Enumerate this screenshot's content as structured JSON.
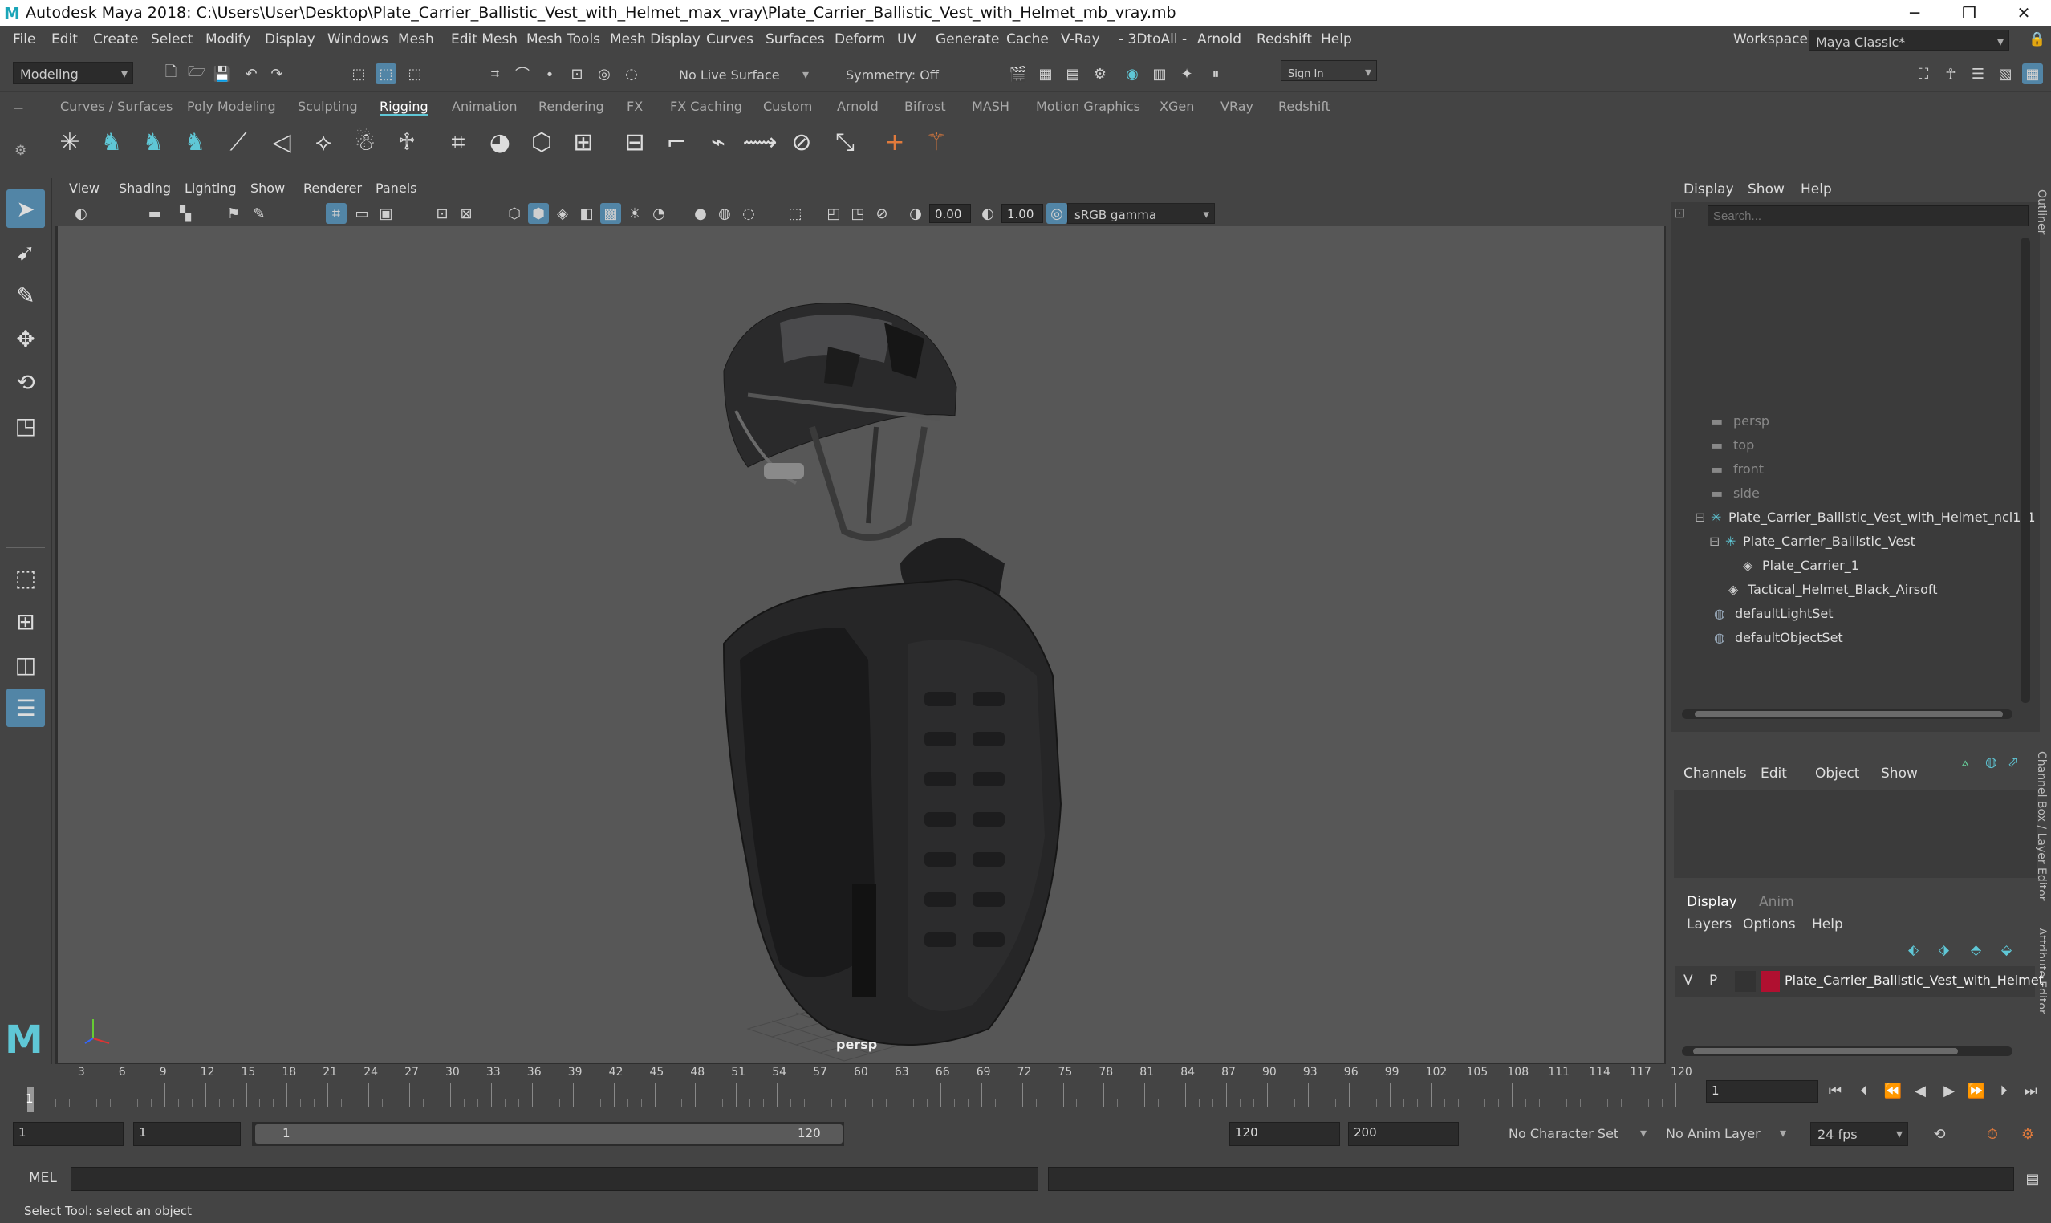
{
  "title_bar": {
    "logo": "M",
    "title": "Autodesk Maya 2018: C:\\Users\\User\\Desktop\\Plate_Carrier_Ballistic_Vest_with_Helmet_max_vray\\Plate_Carrier_Ballistic_Vest_with_Helmet_mb_vray.mb",
    "minimize": "─",
    "maximize": "❐",
    "close": "✕"
  },
  "menu": [
    "File",
    "Edit",
    "Create",
    "Select",
    "Modify",
    "Display",
    "Windows",
    "Mesh",
    "Edit Mesh",
    "Mesh Tools",
    "Mesh Display",
    "Curves",
    "Surfaces",
    "Deform",
    "UV",
    "Generate",
    "Cache",
    "V-Ray",
    "- 3DtoAll -",
    "Arnold",
    "Redshift",
    "Help"
  ],
  "workspace": {
    "label": "Workspace :",
    "value": "Maya Classic*"
  },
  "status_line": {
    "mode": "Modeling",
    "live_surface": "No Live Surface",
    "symmetry": "Symmetry: Off",
    "sign_in": "Sign In"
  },
  "shelf_tabs": [
    "Curves / Surfaces",
    "Poly Modeling",
    "Sculpting",
    "Rigging",
    "Animation",
    "Rendering",
    "FX",
    "FX Caching",
    "Custom",
    "Arnold",
    "Bifrost",
    "MASH",
    "Motion Graphics",
    "XGen",
    "VRay",
    "Redshift"
  ],
  "shelf_active": "Rigging",
  "shelf_icons": [
    "joint-icon",
    "humanik-icon",
    "humanik-defs-icon",
    "humanik-control-icon",
    "ik-handle-icon",
    "ik-spline-icon",
    "skin-bind-icon",
    "character-icon",
    "skeleton-icon",
    "lattice-icon",
    "cluster-icon",
    "wrap-icon",
    "blend-shape-icon",
    "bind-skin-icon",
    "paint-weights-icon",
    "constraint-point-icon",
    "constraint-aim-icon",
    "constraint-orient-icon",
    "constraint-parent-icon",
    "constraint-pole-icon",
    "aim-locator-icon",
    "parent-locator-icon"
  ],
  "viewport": {
    "menus": [
      "View",
      "Shading",
      "Lighting",
      "Show",
      "Renderer",
      "Panels"
    ],
    "exposure": "0.00",
    "gamma": "1.00",
    "color_space": "sRGB gamma",
    "camera_label": "persp"
  },
  "outliner": {
    "menus": [
      "Display",
      "Show",
      "Help"
    ],
    "search_placeholder": "Search...",
    "items": [
      {
        "label": "persp",
        "dim": true,
        "type": "camera"
      },
      {
        "label": "top",
        "dim": true,
        "type": "camera"
      },
      {
        "label": "front",
        "dim": true,
        "type": "camera"
      },
      {
        "label": "side",
        "dim": true,
        "type": "camera"
      },
      {
        "label": "Plate_Carrier_Ballistic_Vest_with_Helmet_ncl1_1",
        "dim": false,
        "type": "group"
      },
      {
        "label": "Plate_Carrier_Ballistic_Vest",
        "dim": false,
        "type": "group"
      },
      {
        "label": "Plate_Carrier_1",
        "dim": false,
        "type": "mesh"
      },
      {
        "label": "Tactical_Helmet_Black_Airsoft",
        "dim": false,
        "type": "mesh"
      },
      {
        "label": "defaultLightSet",
        "dim": false,
        "type": "set"
      },
      {
        "label": "defaultObjectSet",
        "dim": false,
        "type": "set"
      }
    ],
    "side_label": "Outliner"
  },
  "channel_box": {
    "menus": [
      "Channels",
      "Edit",
      "Object",
      "Show"
    ],
    "side_label": "Channel Box / Layer Editor",
    "attr_label": "Attribute Editor"
  },
  "layers": {
    "tabs": [
      "Display",
      "Anim"
    ],
    "menus": [
      "Layers",
      "Options",
      "Help"
    ],
    "row": {
      "v": "V",
      "p": "P",
      "name": "Plate_Carrier_Ballistic_Vest_with_Helmet",
      "color": "#b01030"
    }
  },
  "timeline": {
    "ticks": [
      "3",
      "6",
      "9",
      "12",
      "15",
      "18",
      "21",
      "24",
      "27",
      "30",
      "33",
      "36",
      "39",
      "42",
      "45",
      "48",
      "51",
      "54",
      "57",
      "60",
      "63",
      "66",
      "69",
      "72",
      "75",
      "78",
      "81",
      "84",
      "87",
      "90",
      "93",
      "96",
      "99",
      "102",
      "105",
      "108",
      "111",
      "114",
      "117",
      "120"
    ],
    "current_frame": "1",
    "frame_field": "1",
    "start_marker": "1"
  },
  "range": {
    "start": "1",
    "playback_start": "1",
    "slider_start": "1",
    "slider_end": "120",
    "playback_end": "120",
    "end": "200",
    "character_set": "No Character Set",
    "anim_layer": "No Anim Layer",
    "fps": "24 fps"
  },
  "command": {
    "label": "MEL"
  },
  "help_line": "Select Tool: select an object",
  "colors": {
    "accent": "#5fc7d6",
    "panel": "#444444",
    "viewport": "#575757",
    "selection": "#5285a6"
  }
}
